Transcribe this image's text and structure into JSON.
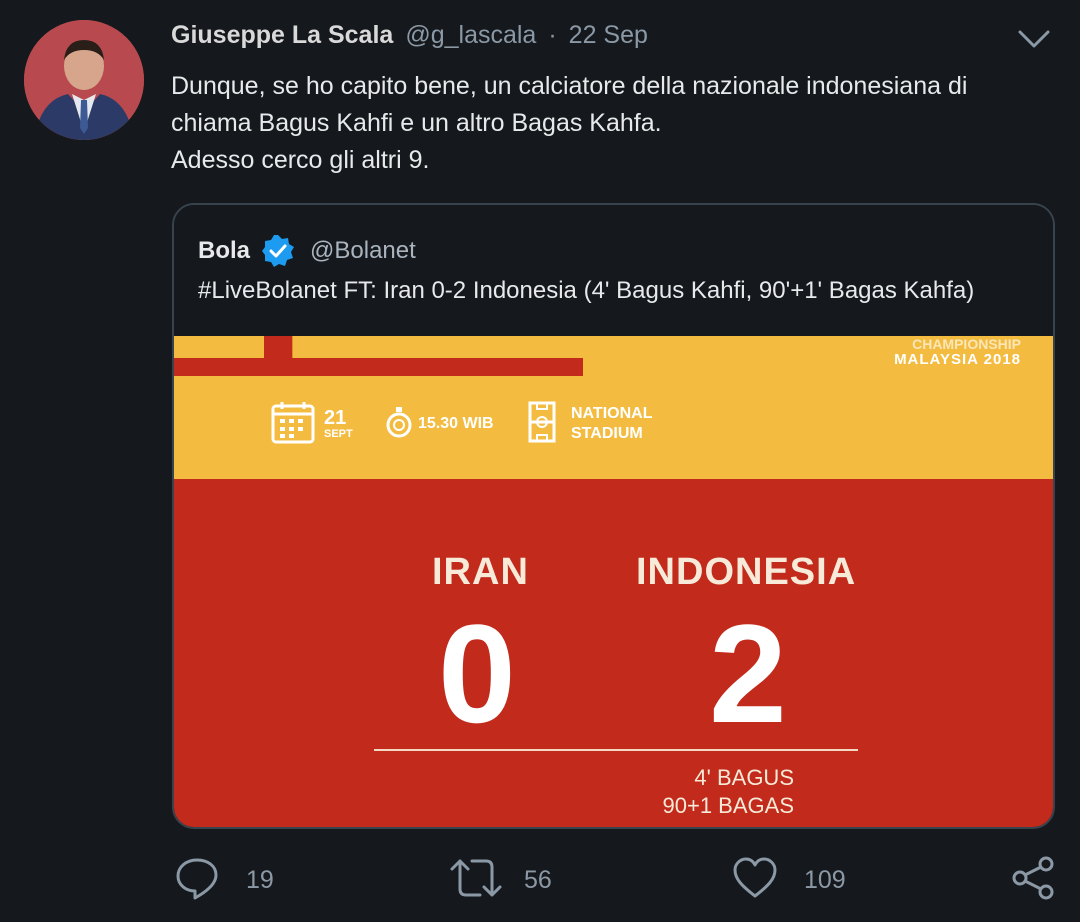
{
  "tweet": {
    "author_name": "Giuseppe La Scala",
    "handle": "@g_lascala",
    "separator": "·",
    "date": "22 Sep",
    "text_lines": [
      "Dunque, se ho capito bene, un calciatore della nazionale indonesiana di",
      "chiama Bagus Kahfi e un altro Bagas Kahfa.",
      "Adesso cerco gli altri 9."
    ]
  },
  "quoted": {
    "author_name": "Bola",
    "handle": "@Bolanet",
    "text": "#LiveBolanet FT: Iran 0-2 Indonesia (4' Bagus Kahfi, 90'+1' Bagas Kahfa)",
    "poster": {
      "championship_line": "CHAMPIONSHIP",
      "location_line": "MALAYSIA 2018",
      "date_day": "21",
      "date_month": "SEPT",
      "time": "15.30 WIB",
      "venue_line1": "NATIONAL",
      "venue_line2": "STADIUM",
      "team_home": "IRAN",
      "team_away": "INDONESIA",
      "score_home": "0",
      "score_away": "2",
      "scorer_1": "4' BAGUS",
      "scorer_2": "90+1 BAGAS",
      "colors": {
        "yellow": "#f3bc40",
        "red": "#c22a1c"
      }
    }
  },
  "actions": {
    "reply_count": "19",
    "retweet_count": "56",
    "like_count": "109"
  },
  "icons": [
    "chevron-down-icon",
    "verified-icon",
    "calendar-icon",
    "stopwatch-icon",
    "stadium-icon",
    "reply-icon",
    "retweet-icon",
    "like-icon",
    "share-icon"
  ]
}
